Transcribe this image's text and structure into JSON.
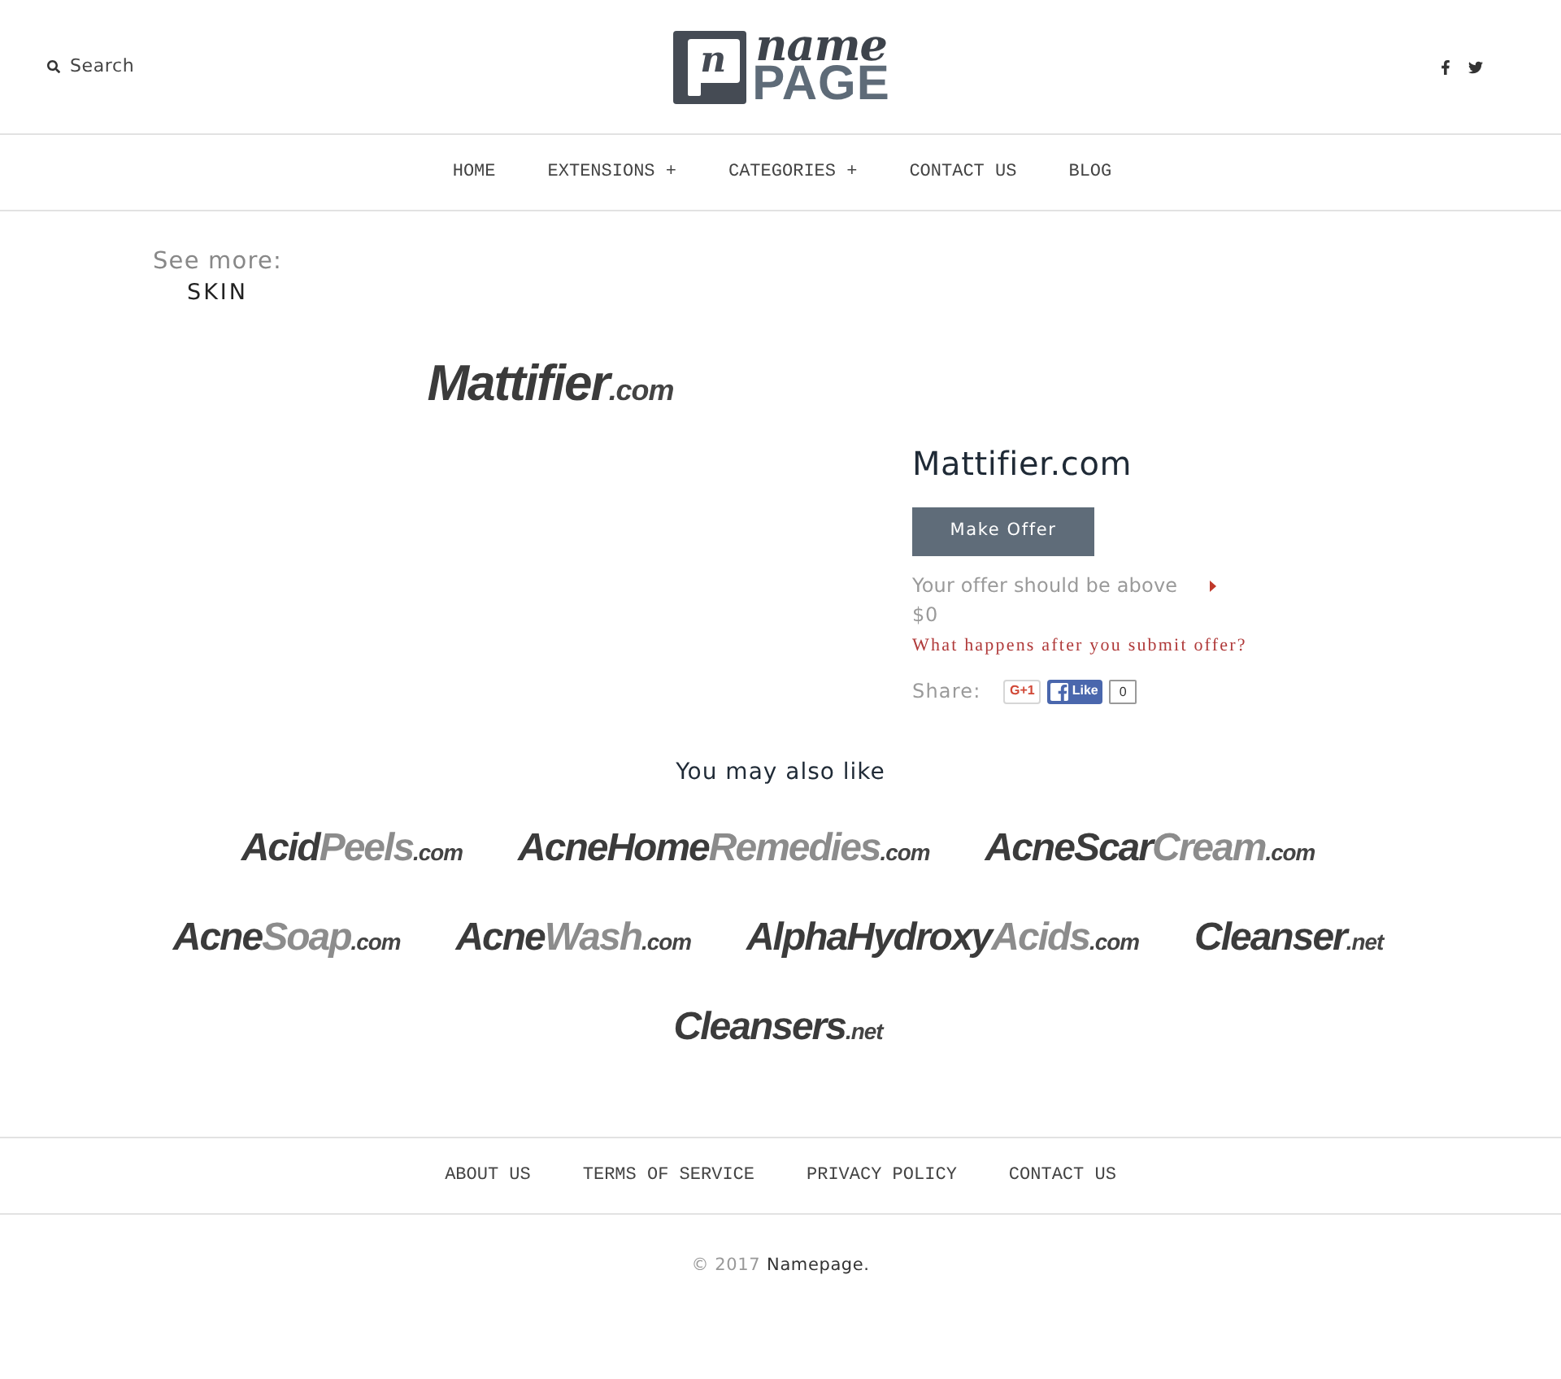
{
  "header": {
    "search": {
      "placeholder": "Search"
    },
    "logo": {
      "monogram": "n",
      "top": "name",
      "bottom": "PAGE"
    }
  },
  "nav": [
    "HOME",
    "EXTENSIONS +",
    "CATEGORIES +",
    "CONTACT US",
    "BLOG"
  ],
  "see_more": {
    "label": "See more:",
    "category": "SKIN"
  },
  "domain": {
    "logo": [
      {
        "text": "Mattifier",
        "kind": "dark"
      },
      {
        "text": ".com",
        "kind": "suffix"
      }
    ],
    "title": "Mattifier.com",
    "offer_button": "Make Offer",
    "offer_hint": "Your offer should be above",
    "min_offer": "$0",
    "help_link": "What happens after you submit offer?",
    "share": {
      "label": "Share:",
      "gplus": "G+1",
      "like": "Like",
      "like_count": "0"
    }
  },
  "also_like": {
    "title": "You may also like",
    "domains": [
      {
        "parts": [
          {
            "text": "Acid",
            "kind": "dark"
          },
          {
            "text": "Peels",
            "kind": "light"
          },
          {
            "text": ".com",
            "kind": "suffix"
          }
        ]
      },
      {
        "parts": [
          {
            "text": "AcneHome",
            "kind": "dark"
          },
          {
            "text": "Remedies",
            "kind": "light"
          },
          {
            "text": ".com",
            "kind": "suffix"
          }
        ]
      },
      {
        "parts": [
          {
            "text": "AcneScar",
            "kind": "dark"
          },
          {
            "text": "Cream",
            "kind": "light"
          },
          {
            "text": ".com",
            "kind": "suffix"
          }
        ]
      },
      {
        "parts": [
          {
            "text": "Acne",
            "kind": "dark"
          },
          {
            "text": "Soap",
            "kind": "light"
          },
          {
            "text": ".com",
            "kind": "suffix"
          }
        ]
      },
      {
        "parts": [
          {
            "text": "Acne",
            "kind": "dark"
          },
          {
            "text": "Wash",
            "kind": "light"
          },
          {
            "text": ".com",
            "kind": "suffix"
          }
        ]
      },
      {
        "parts": [
          {
            "text": "AlphaHydroxy",
            "kind": "dark"
          },
          {
            "text": "Acids",
            "kind": "light"
          },
          {
            "text": ".com",
            "kind": "suffix"
          }
        ]
      },
      {
        "parts": [
          {
            "text": "Cleanser",
            "kind": "dark"
          },
          {
            "text": ".net",
            "kind": "suffix"
          }
        ]
      },
      {
        "parts": [
          {
            "text": "Cleansers",
            "kind": "dark"
          },
          {
            "text": ".net",
            "kind": "suffix"
          }
        ]
      }
    ]
  },
  "footer": {
    "links": [
      "ABOUT US",
      "TERMS OF SERVICE",
      "PRIVACY POLICY",
      "CONTACT US"
    ],
    "copyright": {
      "text": "© 2017",
      "link": "Namepage."
    }
  }
}
